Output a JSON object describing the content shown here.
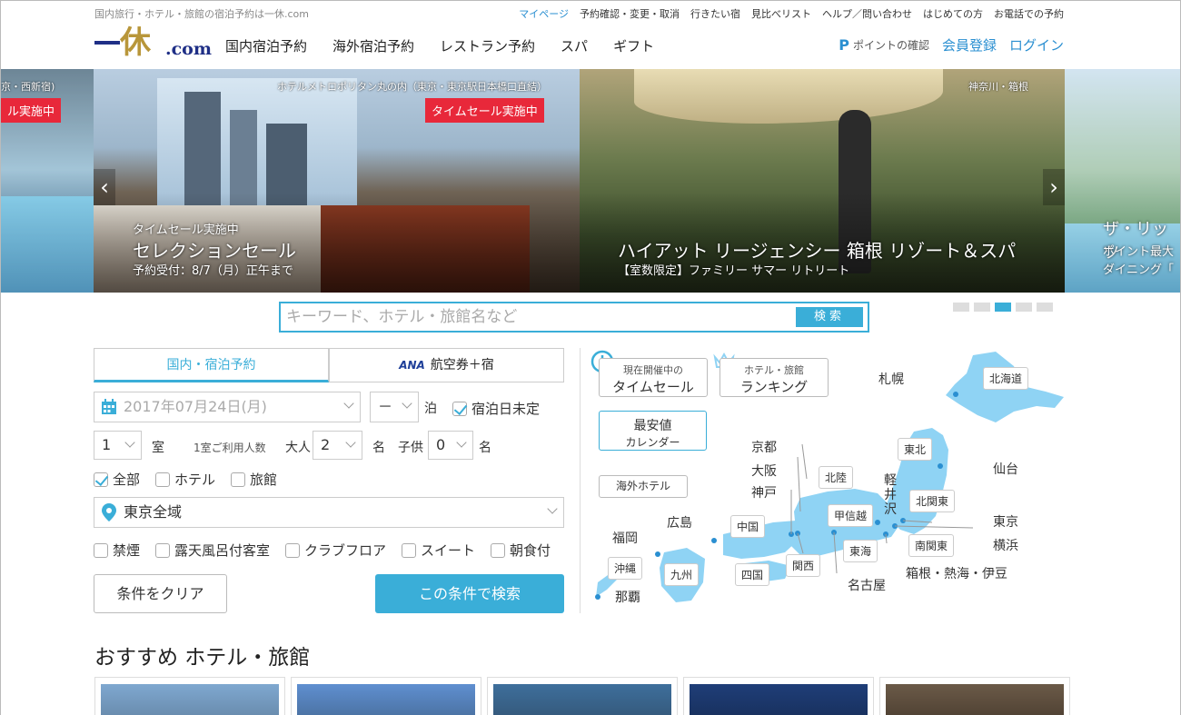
{
  "tagline": "国内旅行・ホテル・旅館の宿泊予約は一休.com",
  "util_links": [
    "マイページ",
    "予約確認・変更・取消",
    "行きたい宿",
    "見比べリスト",
    "ヘルプ／問い合わせ",
    "はじめての方",
    "お電話での予約"
  ],
  "logo": {
    "kanji": "休",
    "suffix": ".com"
  },
  "main_nav": [
    "国内宿泊予約",
    "海外宿泊予約",
    "レストラン予約",
    "スパ",
    "ギフト"
  ],
  "right_nav": {
    "points_icon": "P",
    "points": "ポイントの確認",
    "register": "会員登録",
    "login": "ログイン"
  },
  "hero": {
    "left": {
      "location": "京・西新宿)",
      "badge": "ル実施中"
    },
    "main1": {
      "location": "ホテルメトロポリタン丸の内（東京・東京駅日本橋口直結）",
      "badge": "タイムセール実施中",
      "sub": "タイムセール実施中",
      "title": "セレクションセール",
      "note": "予約受付：8/7（月）正午まで"
    },
    "main2": {
      "location": "神奈川・箱根",
      "title": "ハイアット リージェンシー 箱根 リゾート＆スパ",
      "note": "【室数限定】ファミリー サマー リトリート"
    },
    "right": {
      "title": "ザ・リッツ",
      "line1": "ポイント最大",
      "line2": "ダイニング「"
    },
    "prev": "‹",
    "next": "›",
    "active_dot": 2,
    "dot_count": 5
  },
  "search": {
    "placeholder": "キーワード、ホテル・旅館名など",
    "button": "検索"
  },
  "tabs": {
    "domestic": "国内・宿泊予約",
    "ana_logo": "ANA",
    "ana": "航空券＋宿"
  },
  "form": {
    "date": "2017年07月24日(月)",
    "nights": "－",
    "nights_unit": "泊",
    "undecided": "宿泊日未定",
    "rooms": "1",
    "rooms_unit": "室",
    "persons_label": "1室ご利用人数",
    "adult_label": "大人",
    "adults": "2",
    "adult_unit": "名",
    "child_label": "子供",
    "children": "0",
    "child_unit": "名",
    "types": [
      {
        "label": "全部",
        "checked": true
      },
      {
        "label": "ホテル",
        "checked": false
      },
      {
        "label": "旅館",
        "checked": false
      }
    ],
    "area": "東京全域",
    "options": [
      "禁煙",
      "露天風呂付客室",
      "クラブフロア",
      "スイート",
      "朝食付"
    ],
    "clear": "条件をクリア",
    "submit": "この条件で検索"
  },
  "map": {
    "timesale_small": "現在開催中の",
    "timesale": "タイムセール",
    "ranking_small": "ホテル・旅館",
    "ranking": "ランキング",
    "cheapest": "最安値",
    "calendar": "カレンダー",
    "overseas": "海外ホテル",
    "regions": {
      "hokkaido": "北海道",
      "tohoku": "東北",
      "hokuriku": "北陸",
      "koshinetsu": "甲信越",
      "kitakanto": "北関東",
      "minamikanto": "南関東",
      "tokai": "東海",
      "kansai": "関西",
      "chugoku": "中国",
      "shikoku": "四国",
      "kyushu": "九州",
      "okinawa": "沖縄"
    },
    "cities": {
      "sapporo": "札幌",
      "sendai": "仙台",
      "tokyo": "東京",
      "yokohama": "横浜",
      "hakone": "箱根・熱海・伊豆",
      "nagoya": "名古屋",
      "kyoto": "京都",
      "osaka": "大阪",
      "kobe": "神戸",
      "hiroshima": "広島",
      "fukuoka": "福岡",
      "naha": "那覇",
      "karuizawa": "軽井沢"
    }
  },
  "recommend_title": "おすすめ ホテル・旅館",
  "colors": {
    "accent": "#3aaed8",
    "sale": "#e8283a",
    "logo_navy": "#1f2f86",
    "logo_gold": "#b8963a",
    "map_land": "#8fd3f4"
  }
}
